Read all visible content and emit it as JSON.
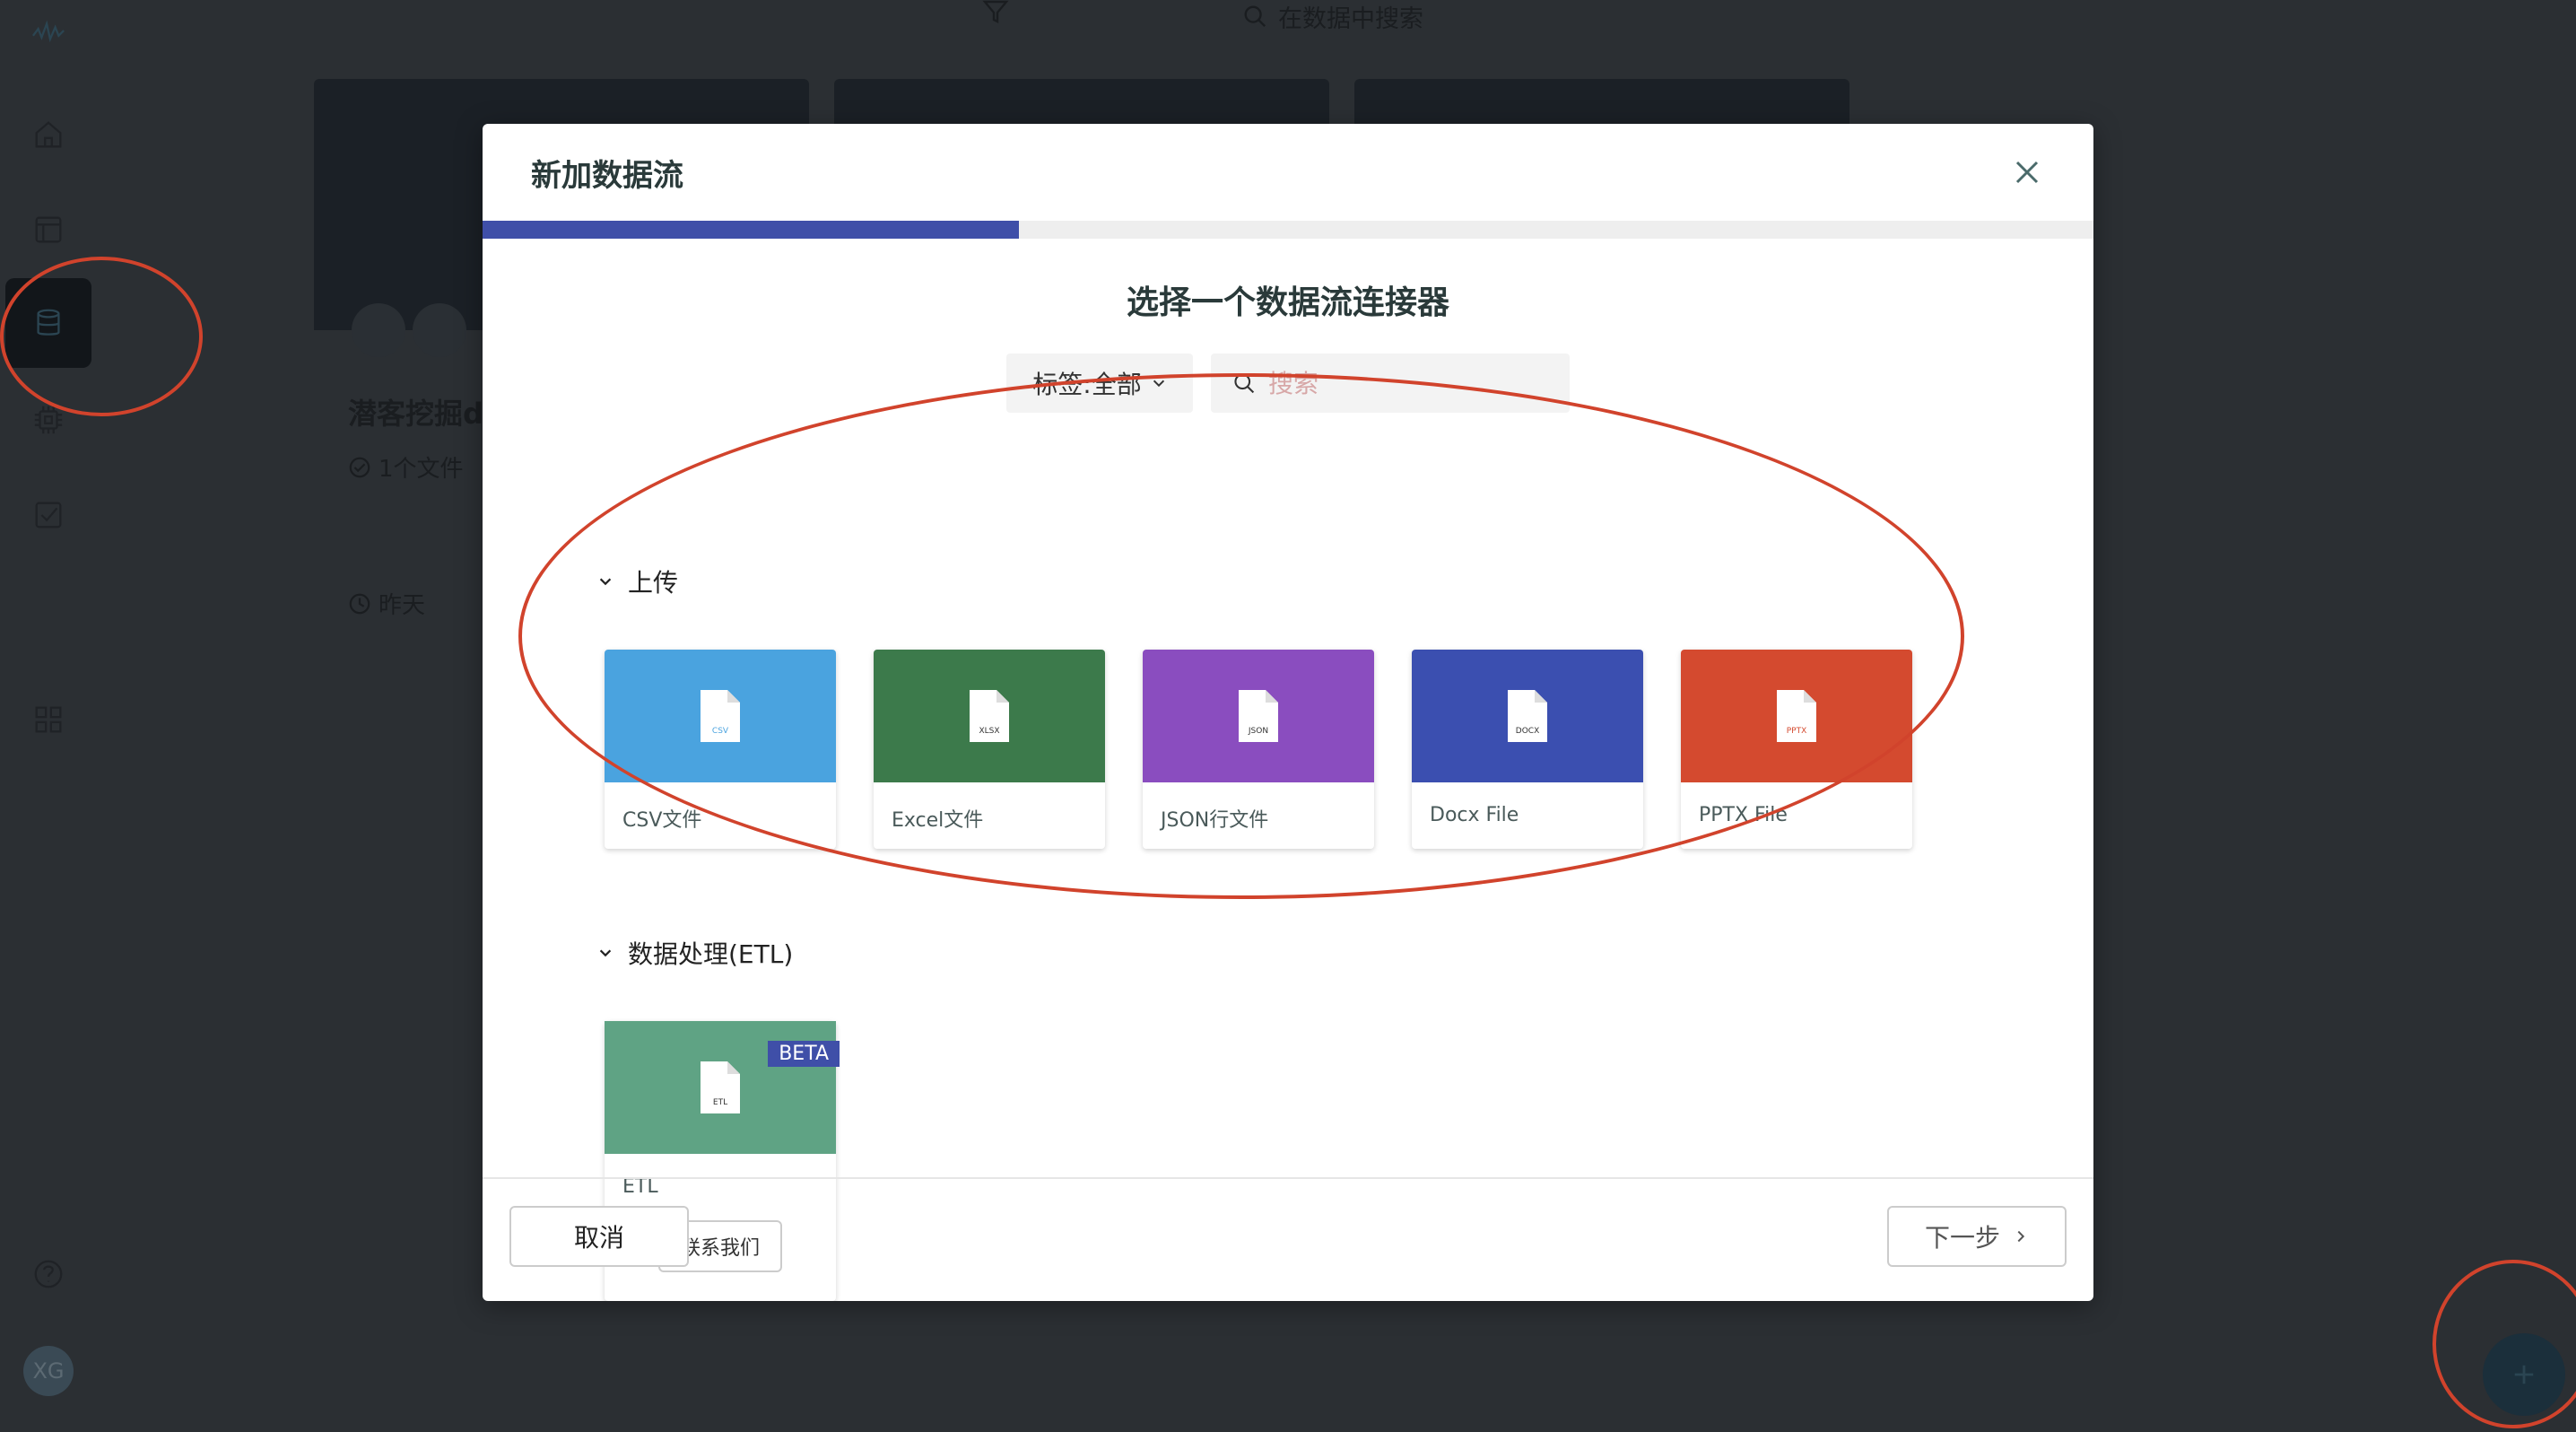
{
  "topbar": {
    "search_label": "在数据中搜索"
  },
  "background": {
    "card_title": "潜客挖掘d",
    "file_count": "1个文件",
    "date": "昨天",
    "avatar_initials": "XG"
  },
  "modal": {
    "title": "新加数据流",
    "progress_fraction": 0.333,
    "step_title": "选择一个数据流连接器",
    "tag_filter_label": "标签:全部",
    "search_placeholder": "搜索",
    "sections": [
      {
        "title": "上传",
        "items": [
          {
            "label": "CSV文件",
            "ext": "CSV",
            "color": "#4aa3df"
          },
          {
            "label": "Excel文件",
            "ext": "XLSX",
            "color": "#3c7a4b"
          },
          {
            "label": "JSON行文件",
            "ext": "JSON",
            "color": "#8a4dbf"
          },
          {
            "label": "Docx File",
            "ext": "DOCX",
            "color": "#3b4fb0"
          },
          {
            "label": "PPTX File",
            "ext": "PPTX",
            "color": "#d44a2f"
          }
        ]
      },
      {
        "title": "数据处理(ETL)",
        "items": [
          {
            "label": "ETL",
            "ext": "ETL",
            "color": "#5fa384",
            "badge": "BETA",
            "action": "联系我们"
          }
        ]
      }
    ],
    "cancel_label": "取消",
    "next_label": "下一步"
  },
  "colors": {
    "accent": "#3f4fa8",
    "annotation": "#d1432c"
  }
}
